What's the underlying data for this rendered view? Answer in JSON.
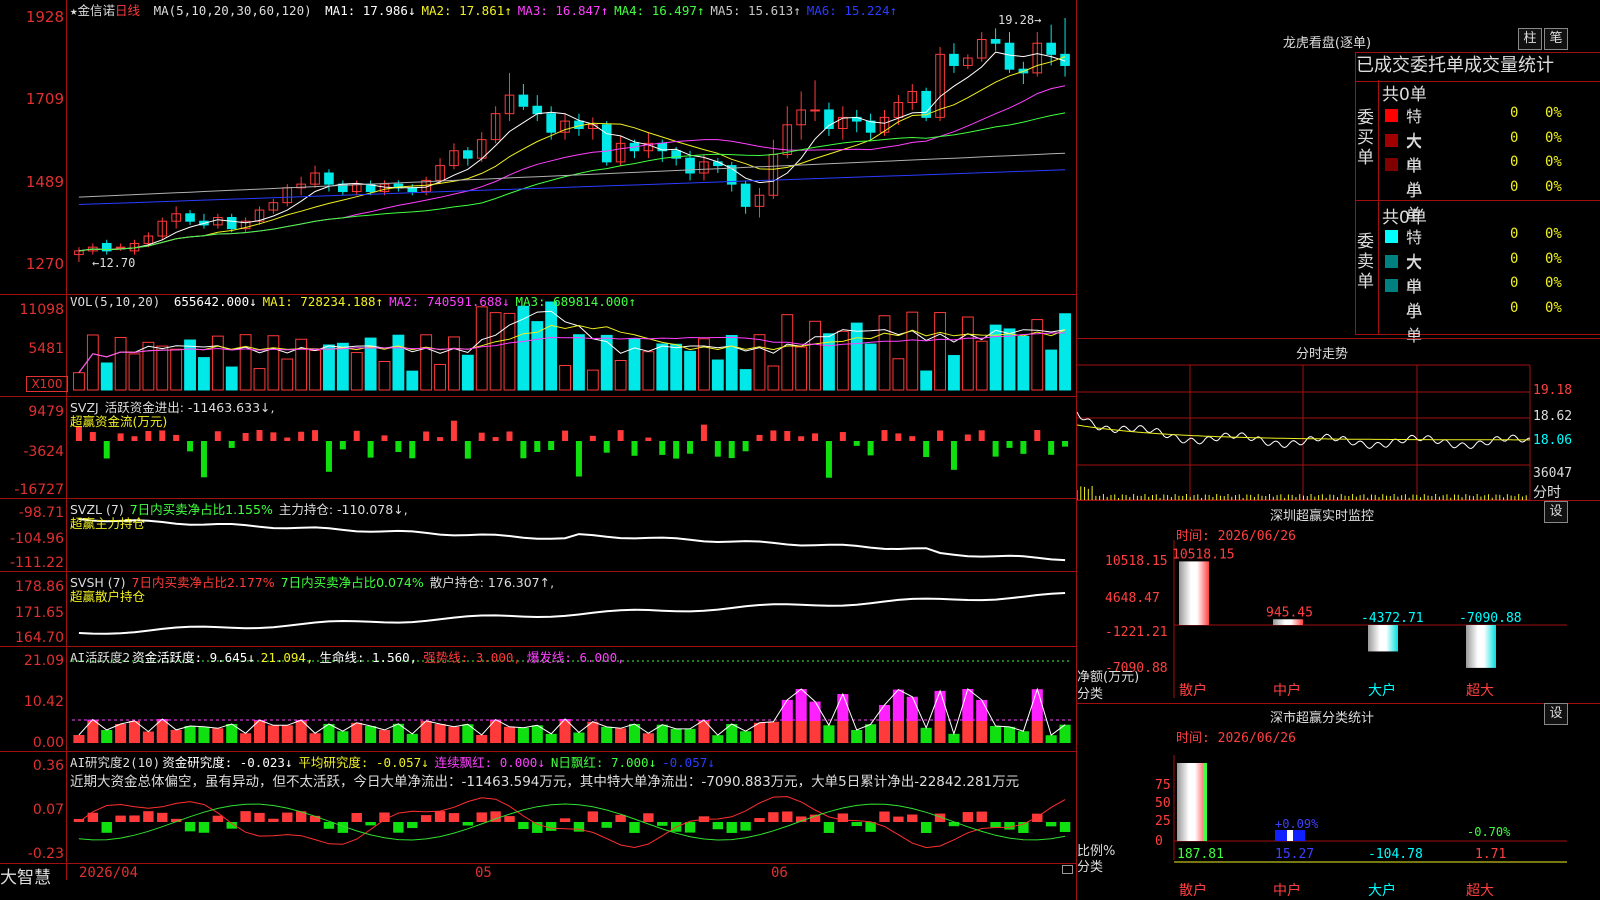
{
  "colors": {
    "up": "#ff3a3a",
    "down": "#00e8e8",
    "grid": "#a01010",
    "white": "#ffffff",
    "yellow": "#f0f020",
    "magenta": "#ff40ff",
    "green": "#40ff40",
    "gray": "#b0b0b0",
    "blue": "#2a3cff",
    "cyan": "#00ffff"
  },
  "stock": {
    "name": "★金信诺",
    "period": "日线",
    "indicator": "MA(5,10,20,30,60,120)"
  },
  "price_pane": {
    "ma": [
      {
        "label": "MA1: 17.986↓",
        "color": "#ffffff"
      },
      {
        "label": "MA2: 17.861↑",
        "color": "#f0f020"
      },
      {
        "label": "MA3: 16.847↑",
        "color": "#ff40ff"
      },
      {
        "label": "MA4: 16.497↑",
        "color": "#40ff40"
      },
      {
        "label": "MA5: 15.613↑",
        "color": "#c8c8c8"
      },
      {
        "label": "MA6: 15.224↑",
        "color": "#2a3cff"
      }
    ],
    "y_labels": [
      "1928",
      "1709",
      "1489",
      "1270"
    ],
    "high_marker": "19.28",
    "low_marker": "12.70"
  },
  "vol_pane": {
    "header": "VOL(5,10,20)",
    "items": [
      {
        "label": "655642.000↓",
        "color": "#ffffff"
      },
      {
        "label": "MA1: 728234.188↑",
        "color": "#f0f020"
      },
      {
        "label": "MA2: 740591.688↓",
        "color": "#ff40ff"
      },
      {
        "label": "MA3: 689814.000↑",
        "color": "#40ff40"
      }
    ],
    "y_labels": [
      "11098",
      "5481"
    ],
    "unit": "X100"
  },
  "svzj_pane": {
    "header": "SVZJ",
    "line1": "活跃资金进出: -11463.633↓,",
    "line2": "超赢资金流(万元)",
    "y_labels": [
      "9479",
      "-3624",
      "-16727"
    ]
  },
  "svzl_pane": {
    "header": "SVZL (7)",
    "line1a": "7日内买卖净占比1.155%",
    "line1b": "主力持仓: -110.078↓,",
    "line2": "超赢主力持仓",
    "y_labels": [
      "-98.71",
      "-104.96",
      "-111.22"
    ]
  },
  "svsh_pane": {
    "header": "SVSH (7)",
    "line1a": "7日内买卖净占比2.177%",
    "line1b": "7日内买卖净占比0.074%",
    "line1c": "散户持仓: 176.307↑,",
    "line2": "超赢散户持仓",
    "y_labels": [
      "178.86",
      "171.65",
      "164.70"
    ]
  },
  "ai1_pane": {
    "header": "AI活跃度2",
    "items": [
      {
        "label": "资金活跃度: 9.645↓",
        "color": "#ffffff"
      },
      {
        "label": "21.094,",
        "color": "#f0f020"
      },
      {
        "label": "生命线: 1.560,",
        "color": "#ffffff"
      },
      {
        "label": "强势线: 3.000,",
        "color": "#ff3a3a"
      },
      {
        "label": "爆发线: 6.000,",
        "color": "#ff40ff"
      }
    ],
    "y_labels": [
      "21.09",
      "10.42",
      "0.00"
    ]
  },
  "ai2_pane": {
    "header": "AI研究度2(10)",
    "items": [
      {
        "label": "资金研究度: -0.023↓",
        "color": "#ffffff"
      },
      {
        "label": "平均研究度: -0.057↓",
        "color": "#f0f020"
      },
      {
        "label": "连续飘红: 0.000↓",
        "color": "#ff40ff"
      },
      {
        "label": "N日飘红: 7.000↓",
        "color": "#40ff40"
      },
      {
        "label": "-0.057↓",
        "color": "#2a3cff"
      }
    ],
    "commentary": "近期大资金总体偏空，虽有异动，但不太活跃，今日大单净流出：-11463.594万元，其中特大单净流出：-7090.883万元，大单5日累计净出-22842.281万元",
    "y_labels": [
      "0.36",
      "0.07",
      "-0.23"
    ]
  },
  "bottom_bar": {
    "brand": "大智慧",
    "date_start": "2026/04",
    "month_05": "05",
    "month_06": "06"
  },
  "longhu": {
    "title": "龙虎看盘(逐单)",
    "btn_bar": "柱",
    "btn_pen": "笔",
    "tabs": [
      "已成交委托单成交量统计"
    ],
    "buy_label": "委买单",
    "sell_label": "委卖单",
    "buy_total": "共0单",
    "sell_total": "共0单",
    "buy_rows": [
      {
        "name": "特大",
        "count": "0",
        "pct": "0%",
        "color": "#ff0000"
      },
      {
        "name": "大单",
        "count": "0",
        "pct": "0%",
        "color": "#a00000"
      },
      {
        "name": "中单",
        "count": "0",
        "pct": "0%",
        "color": "#800000"
      },
      {
        "name": "小单",
        "count": "0",
        "pct": "0%",
        "color": ""
      }
    ],
    "sell_rows": [
      {
        "name": "特大",
        "count": "0",
        "pct": "0%",
        "color": "#00ffff"
      },
      {
        "name": "大单",
        "count": "0",
        "pct": "0%",
        "color": "#008080"
      },
      {
        "name": "中单",
        "count": "0",
        "pct": "0%",
        "color": "#008080"
      },
      {
        "name": "小单",
        "count": "0",
        "pct": "0%",
        "color": ""
      }
    ]
  },
  "intraday": {
    "title": "分时走势",
    "y_labels": [
      "19.18",
      "18.62",
      "18.06"
    ],
    "vol_label": "36047",
    "vol_unit": "分时"
  },
  "monitor": {
    "title": "深圳超赢实时监控",
    "btn": "设",
    "time": "时间: 2026/06/26",
    "y_labels": [
      "10518.15",
      "4648.47",
      "-1221.21",
      "-7090.88"
    ],
    "ylabel": "净额(万元)",
    "xlabel": "分类",
    "categories": [
      "散户",
      "中户",
      "大户",
      "超大"
    ],
    "values_text": [
      "10518.15",
      "945.45",
      "-4372.71",
      "-7090.88"
    ]
  },
  "classify": {
    "title": "深市超赢分类统计",
    "btn": "设",
    "time": "时间: 2026/06/26",
    "y_labels": [
      "75",
      "50",
      "25",
      "0"
    ],
    "ylabel": "比例%",
    "xlabel": "分类",
    "categories": [
      "散户",
      "中户",
      "大户",
      "超大"
    ],
    "values_text": [
      "187.81",
      "15.27",
      "-104.78",
      "1.71"
    ],
    "pct_text": [
      "+0.09%",
      "-0.70%"
    ]
  },
  "chart_data": {
    "type": "candlestick",
    "ylim": [
      12.7,
      19.28
    ],
    "candles": [
      [
        12.9,
        13.0,
        12.7,
        13.1
      ],
      [
        13.0,
        13.1,
        12.9,
        13.2
      ],
      [
        13.2,
        13.0,
        12.9,
        13.3
      ],
      [
        13.1,
        13.1,
        13.0,
        13.2
      ],
      [
        13.0,
        13.2,
        12.9,
        13.3
      ],
      [
        13.2,
        13.4,
        13.1,
        13.5
      ],
      [
        13.4,
        13.8,
        13.3,
        13.9
      ],
      [
        13.8,
        14.0,
        13.6,
        14.2
      ],
      [
        14.0,
        13.8,
        13.7,
        14.1
      ],
      [
        13.8,
        13.7,
        13.6,
        14.0
      ],
      [
        13.7,
        13.9,
        13.6,
        14.0
      ],
      [
        13.9,
        13.6,
        13.5,
        14.0
      ],
      [
        13.6,
        13.8,
        13.5,
        13.9
      ],
      [
        13.8,
        14.1,
        13.7,
        14.2
      ],
      [
        14.1,
        14.3,
        14.0,
        14.4
      ],
      [
        14.3,
        14.7,
        14.2,
        14.8
      ],
      [
        14.7,
        14.8,
        14.5,
        15.0
      ],
      [
        14.8,
        15.1,
        14.7,
        15.3
      ],
      [
        15.1,
        14.8,
        14.6,
        15.2
      ],
      [
        14.8,
        14.6,
        14.5,
        14.9
      ],
      [
        14.6,
        14.8,
        14.5,
        14.9
      ],
      [
        14.8,
        14.6,
        14.5,
        14.9
      ],
      [
        14.6,
        14.8,
        14.5,
        14.9
      ],
      [
        14.8,
        14.7,
        14.6,
        14.9
      ],
      [
        14.7,
        14.6,
        14.5,
        14.8
      ],
      [
        14.6,
        14.9,
        14.5,
        15.0
      ],
      [
        14.9,
        15.3,
        14.8,
        15.5
      ],
      [
        15.3,
        15.7,
        15.2,
        15.9
      ],
      [
        15.7,
        15.5,
        15.3,
        15.8
      ],
      [
        15.5,
        16.0,
        15.4,
        16.2
      ],
      [
        16.0,
        16.7,
        15.9,
        16.9
      ],
      [
        16.7,
        17.2,
        16.5,
        17.8
      ],
      [
        17.2,
        16.9,
        16.8,
        17.5
      ],
      [
        16.9,
        16.7,
        16.5,
        17.2
      ],
      [
        16.7,
        16.2,
        16.0,
        16.9
      ],
      [
        16.2,
        16.5,
        16.0,
        16.7
      ],
      [
        16.5,
        16.3,
        16.1,
        16.7
      ],
      [
        16.3,
        16.4,
        16.0,
        16.6
      ],
      [
        16.4,
        15.4,
        15.3,
        16.5
      ],
      [
        15.4,
        15.9,
        15.3,
        16.1
      ],
      [
        15.9,
        15.7,
        15.5,
        16.0
      ],
      [
        15.7,
        15.9,
        15.5,
        16.2
      ],
      [
        15.9,
        15.7,
        15.4,
        16.0
      ],
      [
        15.7,
        15.5,
        15.3,
        15.8
      ],
      [
        15.5,
        15.1,
        14.9,
        15.7
      ],
      [
        15.1,
        15.4,
        14.9,
        15.6
      ],
      [
        15.4,
        15.3,
        15.1,
        15.5
      ],
      [
        15.3,
        14.8,
        14.6,
        15.4
      ],
      [
        14.8,
        14.2,
        14.0,
        14.9
      ],
      [
        14.2,
        14.5,
        13.9,
        14.7
      ],
      [
        14.5,
        15.6,
        14.4,
        16.0
      ],
      [
        15.6,
        16.4,
        15.5,
        16.9
      ],
      [
        16.4,
        16.8,
        16.0,
        17.3
      ],
      [
        16.8,
        16.8,
        16.5,
        17.6
      ],
      [
        16.8,
        16.3,
        16.1,
        17.0
      ],
      [
        16.3,
        16.6,
        16.0,
        16.9
      ],
      [
        16.6,
        16.5,
        16.2,
        16.8
      ],
      [
        16.5,
        16.2,
        16.0,
        16.7
      ],
      [
        16.2,
        16.6,
        16.1,
        16.8
      ],
      [
        16.6,
        17.0,
        16.4,
        17.2
      ],
      [
        17.0,
        17.3,
        16.8,
        17.5
      ],
      [
        17.3,
        16.6,
        16.5,
        17.4
      ],
      [
        16.6,
        18.3,
        16.5,
        18.5
      ],
      [
        18.3,
        18.0,
        17.8,
        18.6
      ],
      [
        18.0,
        18.2,
        17.9,
        18.3
      ],
      [
        18.2,
        18.7,
        18.1,
        18.9
      ],
      [
        18.7,
        18.6,
        18.4,
        19.0
      ],
      [
        18.6,
        17.9,
        17.8,
        18.9
      ],
      [
        17.9,
        17.8,
        17.5,
        18.1
      ],
      [
        17.8,
        18.6,
        17.7,
        18.9
      ],
      [
        18.6,
        18.3,
        18.0,
        19.1
      ],
      [
        18.3,
        18.0,
        17.7,
        19.28
      ]
    ]
  }
}
